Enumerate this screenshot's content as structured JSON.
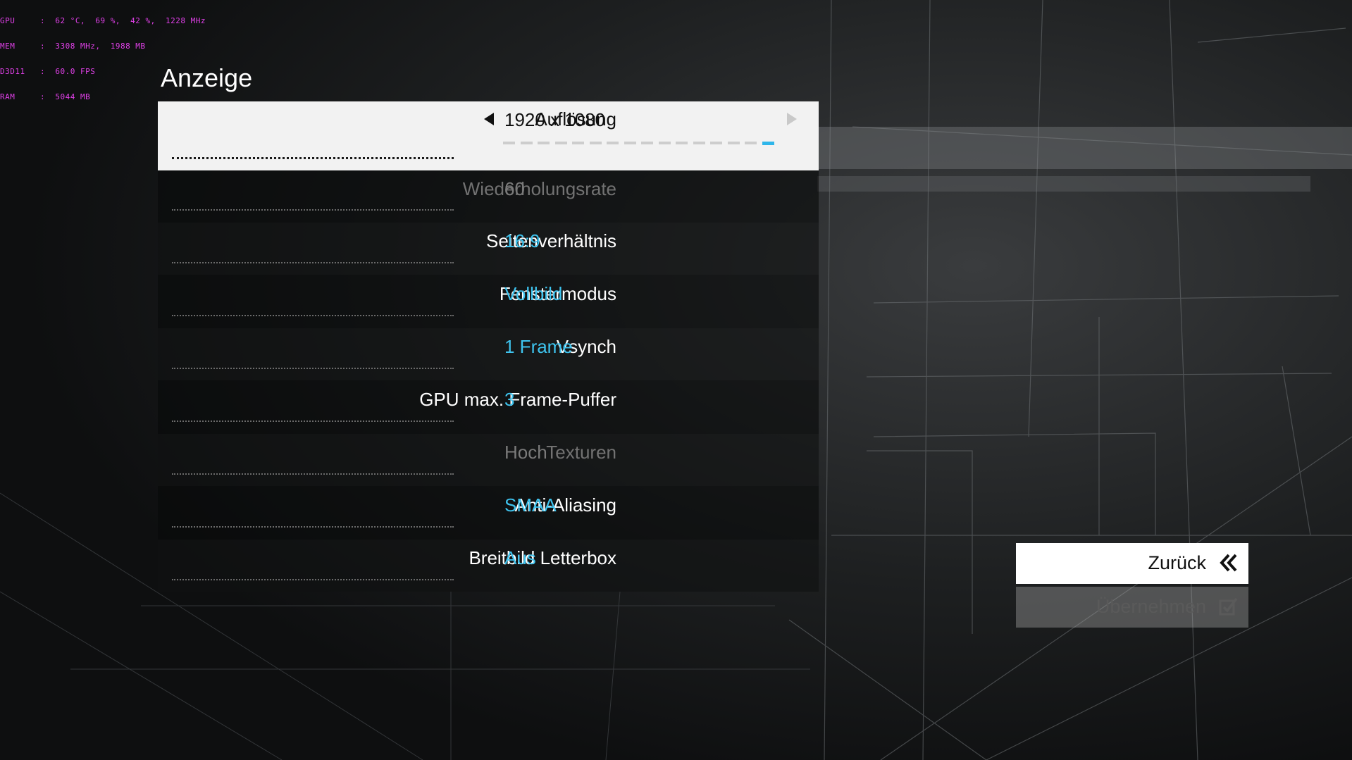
{
  "osd": {
    "lines": [
      "GPU     :  62 °C,  69 %,  42 %,  1228 MHz",
      "MEM     :  3308 MHz,  1988 MB",
      "D3D11   :  60.0 FPS",
      "RAM     :  5044 MB"
    ]
  },
  "page": {
    "title": "Anzeige"
  },
  "settings": [
    {
      "label": "Auflösung",
      "value": "1920 x 1080",
      "state": "selected"
    },
    {
      "label": "Wiederholungsrate",
      "value": "60",
      "state": "disabled"
    },
    {
      "label": "Seitenverhältnis",
      "value": "16:9",
      "state": "normal"
    },
    {
      "label": "Fenstermodus",
      "value": "Vollbild",
      "state": "normal"
    },
    {
      "label": "Vsynch",
      "value": "1 Frame",
      "state": "normal"
    },
    {
      "label": "GPU max. Frame-Puffer",
      "value": "3",
      "state": "normal"
    },
    {
      "label": "Texturen",
      "value": "Hoch",
      "state": "disabled"
    },
    {
      "label": "Anti-Aliasing",
      "value": "SMAA",
      "state": "normal"
    },
    {
      "label": "Breitbild Letterbox",
      "value": "Aus",
      "state": "normal"
    }
  ],
  "resolution_slider": {
    "steps_total": 16,
    "selected_step": 16
  },
  "buttons": {
    "back": {
      "label": "Zurück",
      "icon": "double-chevron-left-icon"
    },
    "apply": {
      "label": "Übernehmen",
      "icon": "apply-checkbox-icon"
    }
  },
  "colors": {
    "value_accent": "#3ec3ee",
    "osd": "#e040e8",
    "selected_row": "#f2f2f2"
  }
}
